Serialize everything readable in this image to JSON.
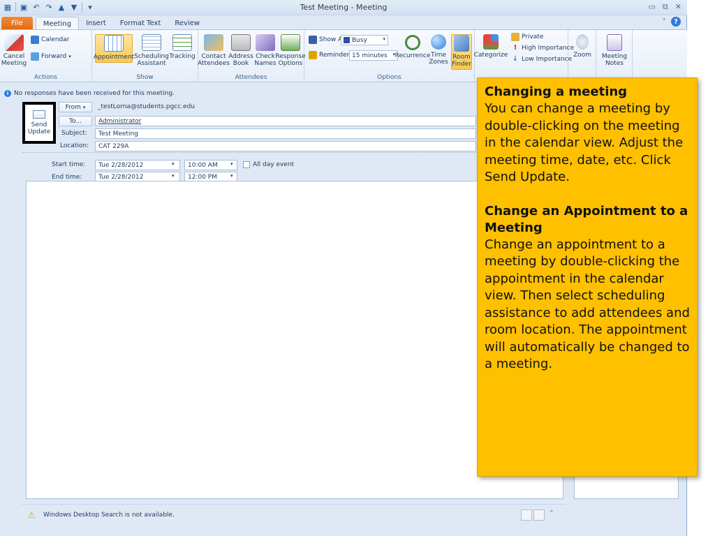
{
  "window": {
    "title": "Test Meeting  -  Meeting",
    "qat_icons": [
      "calendar-icon",
      "save-icon",
      "undo-icon",
      "redo-icon",
      "up-icon",
      "down-icon",
      "customize-icon"
    ],
    "controls": [
      "minimize-icon",
      "restore-icon",
      "close-icon"
    ]
  },
  "tabs": [
    "File",
    "Meeting",
    "Insert",
    "Format Text",
    "Review"
  ],
  "active_tab": "Meeting",
  "ribbon": {
    "actions": {
      "label": "Actions",
      "cancel": "Cancel Meeting",
      "calendar": "Calendar",
      "forward": "Forward"
    },
    "show": {
      "label": "Show",
      "appointment": "Appointment",
      "scheduling": "Scheduling Assistant",
      "tracking": "Tracking"
    },
    "attendees": {
      "label": "Attendees",
      "contact": "Contact Attendees",
      "address": "Address Book",
      "check": "Check Names",
      "response": "Response Options"
    },
    "options": {
      "label": "Options",
      "show_as_label": "Show As:",
      "show_as_value": "Busy",
      "reminder_label": "Reminder:",
      "reminder_value": "15 minutes",
      "recurrence": "Recurrence",
      "time_zones": "Time Zones",
      "room_finder": "Room Finder"
    },
    "tags": {
      "categorize": "Categorize",
      "private": "Private",
      "high": "High Importance",
      "low": "Low Importance"
    },
    "zoom": {
      "zoom": "Zoom"
    },
    "notes": {
      "meeting_notes": "Meeting Notes"
    }
  },
  "infobar": "No responses have been received for this meeting.",
  "form": {
    "send_update": "Send Update",
    "from_label": "From",
    "from_value": "_testLorna@students.pgcc.edu",
    "to_label": "To...",
    "to_value": "Administrator",
    "subject_label": "Subject:",
    "subject_value": "Test Meeting",
    "location_label": "Location:",
    "location_value": "CAT 229A",
    "start_label": "Start time:",
    "start_date": "Tue 2/28/2012",
    "start_time": "10:00 AM",
    "all_day": "All day event",
    "end_label": "End time:",
    "end_date": "Tue 2/28/2012",
    "end_time": "12:00 PM"
  },
  "status": "Windows Desktop Search is not available.",
  "callout": {
    "heading1": "Changing a meeting",
    "text1": "You can change a meeting by double-clicking on the meeting in the calendar view. Adjust the meeting time, date, etc. Click Send Update.",
    "heading2": "Change an Appointment to a Meeting",
    "text2": "Change an appointment to a meeting by double-clicking the appointment in the calendar view. Then select scheduling assistance to add attendees and room location. The appointment will automatically be changed to a meeting."
  },
  "colors": {
    "callout_bg": "#ffc000",
    "file_tab": "#e06a12",
    "selected_button": "#f9c94f"
  }
}
